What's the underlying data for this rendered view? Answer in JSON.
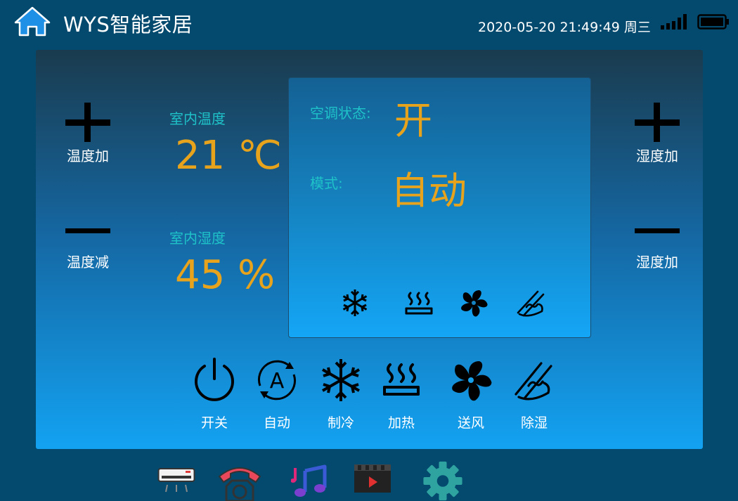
{
  "header": {
    "title": "WYS智能家居",
    "datetime": "2020-05-20 21:49:49 周三"
  },
  "left_controls": {
    "temp_up_label": "温度加",
    "temp_down_label": "温度减"
  },
  "right_controls": {
    "humidity_up_label": "湿度加",
    "humidity_down_label": "湿度加"
  },
  "readings": {
    "temperature_label": "室内温度",
    "temperature_value": "21 ℃",
    "humidity_label": "室内湿度",
    "humidity_value": "45 %"
  },
  "status": {
    "ac_label": "空调状态:",
    "ac_value": "开",
    "mode_label": "模式:",
    "mode_value": "自动"
  },
  "modes": [
    {
      "label": "开关"
    },
    {
      "label": "自动"
    },
    {
      "label": "制冷"
    },
    {
      "label": "加热"
    },
    {
      "label": "送风"
    },
    {
      "label": "除湿"
    }
  ],
  "colors": {
    "accent_orange": "#e8a31c",
    "label_cyan": "#1ec2c8",
    "background": "#034a6e"
  },
  "icons": [
    "home-icon",
    "signal-icon",
    "battery-icon",
    "plus-icon",
    "minus-icon",
    "power-icon",
    "auto-icon",
    "snowflake-icon",
    "heat-icon",
    "fan-icon",
    "dehumidify-icon",
    "air-conditioner-icon",
    "telephone-icon",
    "music-icon",
    "video-icon",
    "settings-gear-icon"
  ]
}
